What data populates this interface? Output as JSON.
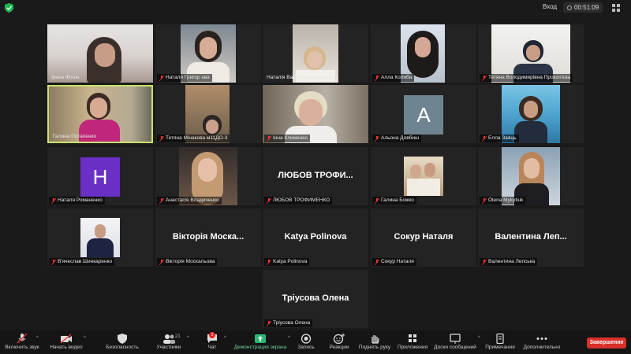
{
  "header": {
    "login_label": "Вход",
    "timer": "00:51:09"
  },
  "participants": [
    {
      "name": "Ірина Філон"
    },
    {
      "name": "Наталя Григор єва"
    },
    {
      "name": "Наталія Валеріївна Науменко"
    },
    {
      "name": "Алла Колиба"
    },
    {
      "name": "Тетяна Володимирівна Прокоп'єва"
    },
    {
      "name": "Галина Потапенко"
    },
    {
      "name": "Тетяна Мінакова м11ДО-3"
    },
    {
      "name": "Інна Клименко"
    },
    {
      "name": "Альона Довбиш",
      "avatar": "A"
    },
    {
      "name": "Елла Заяць"
    },
    {
      "name": "Наталя Романенко",
      "avatar": "H"
    },
    {
      "name": "Анастасія Владиченко"
    },
    {
      "name": "ЛЮБОВ ТРОФИМЕНКО",
      "big": "ЛЮБОВ  ТРОФИ..."
    },
    {
      "name": "Галина Божко"
    },
    {
      "name": "Olena Mykytiuk"
    },
    {
      "name": "В'ячеслав Шинкаренко"
    },
    {
      "name": "Вікторія Москальова",
      "big": "Вікторія  Моска..."
    },
    {
      "name": "Katya Polinova",
      "big": "Katya Polinova"
    },
    {
      "name": "Сокур Наталя",
      "big": "Сокур Наталя"
    },
    {
      "name": "Валентина Лепська",
      "big": "Валентина  Леп..."
    },
    {
      "name": "Тріусова Олена",
      "big": "Тріусова Олена"
    }
  ],
  "toolbar": {
    "unmute": "Включить звук",
    "video": "Начать видео",
    "security": "Безопасность",
    "participants": "Участники",
    "participants_count": "21",
    "chat": "Чат",
    "chat_badge": "3",
    "share": "Демонстрация экрана",
    "record": "Запись",
    "reactions": "Реакции",
    "raise_hand": "Поднять руку",
    "apps": "Приложения",
    "whiteboards": "Доски сообщений",
    "notes": "Примечания",
    "more": "Дополнительно",
    "end": "Завершение"
  },
  "colors": {
    "active_speaker_border": "#c9e26b",
    "share_icon": "#2bb673",
    "end_button": "#d9302c",
    "avatar_A": "#6e8491",
    "avatar_H": "#6a2fc4"
  }
}
